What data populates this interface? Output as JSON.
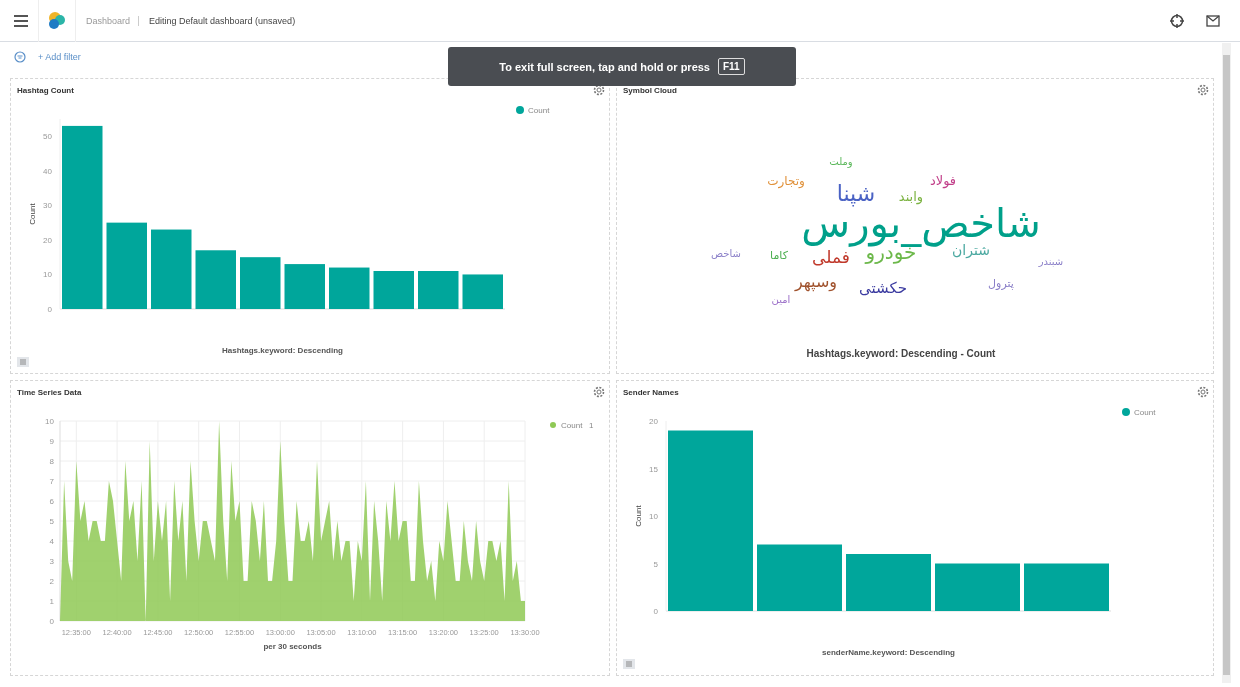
{
  "header": {
    "breadcrumb": "Dashboard",
    "title": "Editing Default dashboard (unsaved)"
  },
  "filter_bar": {
    "add_filter": "+ Add filter"
  },
  "toast": {
    "text": "To exit full screen, tap and hold or press",
    "key": "F11"
  },
  "panels": {
    "hashtag_count": {
      "title": "Hashtag Count",
      "chart_data": {
        "type": "bar",
        "xlabel": "Hashtags.keyword: Descending",
        "ylabel": "Count",
        "series": [
          {
            "name": "Count",
            "color": "#00a69b",
            "values": [
              53,
              25,
              23,
              17,
              15,
              13,
              12,
              11,
              11,
              10
            ]
          }
        ],
        "ylim": [
          0,
          55
        ],
        "yticks": [
          0,
          10,
          20,
          30,
          40,
          50
        ]
      }
    },
    "symbol_cloud": {
      "kind": "cloud",
      "title": "Symbol Cloud",
      "caption": "Hashtags.keyword: Descending - Count",
      "words": [
        {
          "text": "وملت",
          "color": "#5cb85c"
        },
        {
          "text": "فولاد",
          "color": "#c2408a"
        },
        {
          "text": "وتجارت",
          "color": "#e0913a"
        },
        {
          "text": "وابند",
          "color": "#7cb342"
        },
        {
          "text": "شپنا",
          "color": "#4a62c4"
        },
        {
          "text": "شاخص_بورس",
          "color": "#00a08a"
        },
        {
          "text": "شبندر",
          "color": "#8a7fc8"
        },
        {
          "text": "شتران",
          "color": "#4aa8a0"
        },
        {
          "text": "خودرو",
          "color": "#6cb84a"
        },
        {
          "text": "فملی",
          "color": "#c0392b"
        },
        {
          "text": "کاما",
          "color": "#4caf50"
        },
        {
          "text": "شاخص",
          "color": "#8a7fc8"
        },
        {
          "text": "پترول",
          "color": "#8a7fc8"
        },
        {
          "text": "حکشتی",
          "color": "#3b3ba0"
        },
        {
          "text": "وسپهر",
          "color": "#a0522d"
        },
        {
          "text": "امین",
          "color": "#9b6fc8"
        }
      ]
    },
    "time_series_data": {
      "title": "Time Series Data",
      "legend_value": "1",
      "chart_data": {
        "type": "area",
        "xlabel": "per 30 seconds",
        "categories": [
          null,
          null,
          null,
          null,
          "12:35:00",
          null,
          null,
          null,
          null,
          null,
          null,
          null,
          null,
          null,
          "12:40:00",
          null,
          null,
          null,
          null,
          null,
          null,
          null,
          null,
          null,
          "12:45:00",
          null,
          null,
          null,
          null,
          null,
          null,
          null,
          null,
          null,
          "12:50:00",
          null,
          null,
          null,
          null,
          null,
          null,
          null,
          null,
          null,
          "12:55:00",
          null,
          null,
          null,
          null,
          null,
          null,
          null,
          null,
          null,
          "13:00:00",
          null,
          null,
          null,
          null,
          null,
          null,
          null,
          null,
          null,
          "13:05:00",
          null,
          null,
          null,
          null,
          null,
          null,
          null,
          null,
          null,
          "13:10:00",
          null,
          null,
          null,
          null,
          null,
          null,
          null,
          null,
          null,
          "13:15:00",
          null,
          null,
          null,
          null,
          null,
          null,
          null,
          null,
          null,
          "13:20:00",
          null,
          null,
          null,
          null,
          null,
          null,
          null,
          null,
          null,
          "13:25:00",
          null,
          null,
          null,
          null,
          null,
          null,
          null,
          null,
          null,
          "13:30:00"
        ],
        "grid": true,
        "ylim": [
          0,
          10
        ],
        "series": [
          {
            "name": "Count",
            "color": "#8fc955",
            "values": [
              0,
              7,
              3,
              2,
              8,
              5,
              6,
              4,
              5,
              5,
              4,
              4,
              7,
              6,
              4,
              2,
              8,
              5,
              6,
              3,
              7,
              0,
              9,
              3,
              6,
              4,
              6,
              1,
              7,
              4,
              6,
              2,
              8,
              5,
              3,
              5,
              5,
              4,
              3,
              10,
              5,
              2,
              8,
              5,
              6,
              2,
              2,
              6,
              5,
              3,
              6,
              2,
              2,
              4,
              9,
              5,
              2,
              2,
              6,
              4,
              4,
              5,
              3,
              8,
              4,
              5,
              6,
              3,
              5,
              3,
              4,
              4,
              1,
              4,
              3,
              7,
              1,
              6,
              4,
              1,
              6,
              4,
              7,
              4,
              5,
              5,
              2,
              2,
              7,
              4,
              2,
              3,
              1,
              4,
              3,
              6,
              4,
              2,
              2,
              5,
              3,
              2,
              5,
              3,
              2,
              4,
              4,
              3,
              4,
              1,
              7,
              2,
              3,
              1,
              1
            ]
          }
        ],
        "yticks": [
          0,
          1,
          2,
          3,
          4,
          5,
          6,
          7,
          8,
          9,
          10
        ]
      }
    },
    "sender_names": {
      "title": "Sender Names",
      "chart_data": {
        "type": "bar",
        "xlabel": "senderName.keyword: Descending",
        "ylabel": "Count",
        "series": [
          {
            "name": "Count",
            "color": "#00a69b",
            "values": [
              19,
              7,
              6,
              5,
              5
            ]
          }
        ],
        "ylim": [
          0,
          20
        ],
        "yticks": [
          0,
          5,
          10,
          15,
          20
        ]
      }
    }
  }
}
